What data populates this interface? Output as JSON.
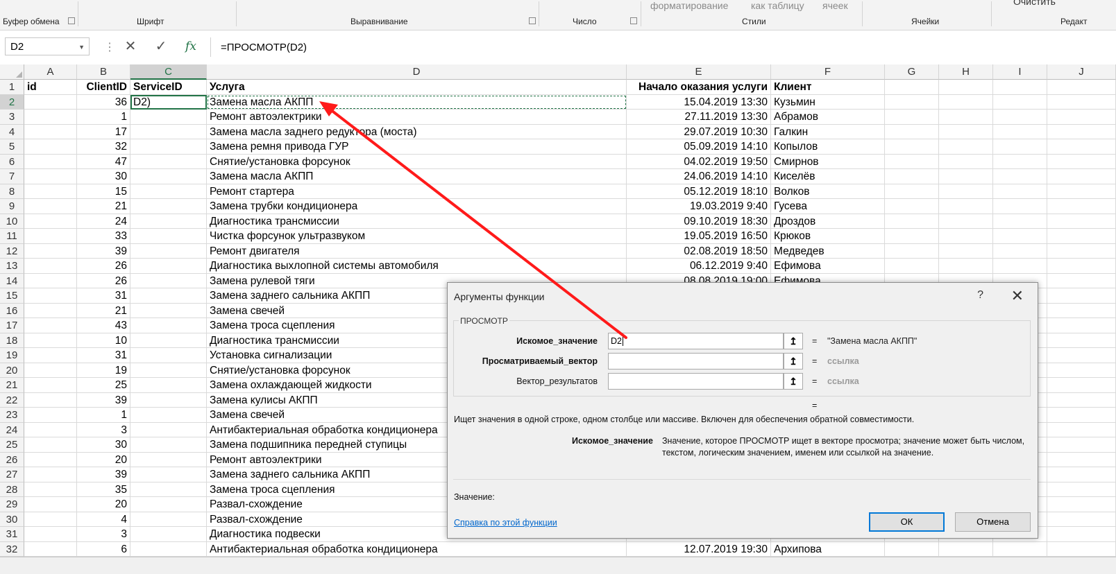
{
  "ribbon": {
    "groups": [
      {
        "label": "Буфер обмена"
      },
      {
        "label": "Шрифт"
      },
      {
        "label": "Выравнивание"
      },
      {
        "label": "Число"
      },
      {
        "label": "Стили"
      },
      {
        "label": "Ячейки"
      },
      {
        "label": "Редакт"
      }
    ],
    "styles_items": [
      "форматирование",
      "как таблицу",
      "ячеек"
    ],
    "clear_label": "Очистить"
  },
  "formula_bar": {
    "name_box": "D2",
    "formula": "=ПРОСМОТР(D2)",
    "cancel_icon": "cross-icon",
    "enter_icon": "check-icon",
    "fx_label": "fx"
  },
  "columns": [
    "A",
    "B",
    "C",
    "D",
    "E",
    "F",
    "G",
    "H",
    "I",
    "J"
  ],
  "rows": [
    {
      "n": "1",
      "a": "id",
      "b": "ClientID",
      "c": "ServiceID",
      "d": "Услуга",
      "e": "Начало оказания услуги",
      "f": "Клиент"
    },
    {
      "n": "2",
      "a": "",
      "b": "36",
      "c": "D2)",
      "d": "Замена масла АКПП",
      "e": "15.04.2019 13:30",
      "f": "Кузьмин"
    },
    {
      "n": "3",
      "a": "",
      "b": "1",
      "c": "",
      "d": "Ремонт автоэлектрики",
      "e": "27.11.2019 13:30",
      "f": "Абрамов"
    },
    {
      "n": "4",
      "a": "",
      "b": "17",
      "c": "",
      "d": "Замена масла заднего редуктора (моста)",
      "e": "29.07.2019 10:30",
      "f": "Галкин"
    },
    {
      "n": "5",
      "a": "",
      "b": "32",
      "c": "",
      "d": "Замена ремня привода ГУР",
      "e": "05.09.2019 14:10",
      "f": "Копылов"
    },
    {
      "n": "6",
      "a": "",
      "b": "47",
      "c": "",
      "d": "Снятие/установка форсунок",
      "e": "04.02.2019 19:50",
      "f": "Смирнов"
    },
    {
      "n": "7",
      "a": "",
      "b": "30",
      "c": "",
      "d": "Замена масла АКПП",
      "e": "24.06.2019 14:10",
      "f": "Киселёв"
    },
    {
      "n": "8",
      "a": "",
      "b": "15",
      "c": "",
      "d": "Ремонт стартера",
      "e": "05.12.2019 18:10",
      "f": "Волков"
    },
    {
      "n": "9",
      "a": "",
      "b": "21",
      "c": "",
      "d": "Замена трубки кондиционера",
      "e": "19.03.2019 9:40",
      "f": "Гусева"
    },
    {
      "n": "10",
      "a": "",
      "b": "24",
      "c": "",
      "d": "Диагностика трансмиссии",
      "e": "09.10.2019 18:30",
      "f": "Дроздов"
    },
    {
      "n": "11",
      "a": "",
      "b": "33",
      "c": "",
      "d": "Чистка форсунок ультразвуком",
      "e": "19.05.2019 16:50",
      "f": "Крюков"
    },
    {
      "n": "12",
      "a": "",
      "b": "39",
      "c": "",
      "d": "Ремонт двигателя",
      "e": "02.08.2019 18:50",
      "f": "Медведев"
    },
    {
      "n": "13",
      "a": "",
      "b": "26",
      "c": "",
      "d": "Диагностика выхлопной системы автомобиля",
      "e": "06.12.2019 9:40",
      "f": "Ефимова"
    },
    {
      "n": "14",
      "a": "",
      "b": "26",
      "c": "",
      "d": "Замена рулевой тяги",
      "e": "08.08.2019 19:00",
      "f": "Ефимова"
    },
    {
      "n": "15",
      "a": "",
      "b": "31",
      "c": "",
      "d": "Замена заднего сальника АКПП",
      "e": "",
      "f": ""
    },
    {
      "n": "16",
      "a": "",
      "b": "21",
      "c": "",
      "d": "Замена свечей",
      "e": "",
      "f": ""
    },
    {
      "n": "17",
      "a": "",
      "b": "43",
      "c": "",
      "d": "Замена троса сцепления",
      "e": "",
      "f": ""
    },
    {
      "n": "18",
      "a": "",
      "b": "10",
      "c": "",
      "d": "Диагностика трансмиссии",
      "e": "",
      "f": ""
    },
    {
      "n": "19",
      "a": "",
      "b": "31",
      "c": "",
      "d": "Установка сигнализации",
      "e": "",
      "f": ""
    },
    {
      "n": "20",
      "a": "",
      "b": "19",
      "c": "",
      "d": "Снятие/установка форсунок",
      "e": "",
      "f": ""
    },
    {
      "n": "21",
      "a": "",
      "b": "25",
      "c": "",
      "d": "Замена охлаждающей жидкости",
      "e": "",
      "f": ""
    },
    {
      "n": "22",
      "a": "",
      "b": "39",
      "c": "",
      "d": "Замена кулисы АКПП",
      "e": "",
      "f": ""
    },
    {
      "n": "23",
      "a": "",
      "b": "1",
      "c": "",
      "d": "Замена свечей",
      "e": "",
      "f": ""
    },
    {
      "n": "24",
      "a": "",
      "b": "3",
      "c": "",
      "d": "Антибактериальная обработка кондиционера",
      "e": "",
      "f": ""
    },
    {
      "n": "25",
      "a": "",
      "b": "30",
      "c": "",
      "d": "Замена подшипника передней ступицы",
      "e": "",
      "f": ""
    },
    {
      "n": "26",
      "a": "",
      "b": "20",
      "c": "",
      "d": "Ремонт автоэлектрики",
      "e": "",
      "f": ""
    },
    {
      "n": "27",
      "a": "",
      "b": "39",
      "c": "",
      "d": "Замена заднего сальника АКПП",
      "e": "",
      "f": ""
    },
    {
      "n": "28",
      "a": "",
      "b": "35",
      "c": "",
      "d": "Замена троса сцепления",
      "e": "",
      "f": ""
    },
    {
      "n": "29",
      "a": "",
      "b": "20",
      "c": "",
      "d": "Развал-схождение",
      "e": "",
      "f": ""
    },
    {
      "n": "30",
      "a": "",
      "b": "4",
      "c": "",
      "d": "Развал-схождение",
      "e": "",
      "f": ""
    },
    {
      "n": "31",
      "a": "",
      "b": "3",
      "c": "",
      "d": "Диагностика подвески",
      "e": "",
      "f": ""
    },
    {
      "n": "32",
      "a": "",
      "b": "6",
      "c": "",
      "d": "Антибактериальная обработка кондиционера",
      "e": "12.07.2019 19:30",
      "f": "Архипова"
    }
  ],
  "dialog": {
    "title": "Аргументы функции",
    "help_label": "?",
    "close_label": "✕",
    "function_name": "ПРОСМОТР",
    "args": [
      {
        "label": "Искомое_значение",
        "value": "D2",
        "result": "\"Замена масла АКПП\"",
        "bold": true
      },
      {
        "label": "Просматриваемый_вектор",
        "value": "",
        "result": "ссылка",
        "bold": true
      },
      {
        "label": "Вектор_результатов",
        "value": "",
        "result": "ссылка",
        "bold": false
      }
    ],
    "eq": "=",
    "description": "Ищет значения в одной строке, одном столбце или массиве. Включен для обеспечения обратной совместимости.",
    "arg_help_name": "Искомое_значение",
    "arg_help_line1": "Значение, которое ПРОСМОТР ищет в векторе просмотра; значение может быть числом,",
    "arg_help_line2": "текстом, логическим значением, именем или ссылкой на значение.",
    "value_label": "Значение:",
    "help_link": "Справка по этой функции",
    "ok_label": "ОК",
    "cancel_label": "Отмена"
  },
  "colors": {
    "accent_green": "#217346",
    "annotation_arrow": "#ff1a1a",
    "link": "#0066cc"
  }
}
